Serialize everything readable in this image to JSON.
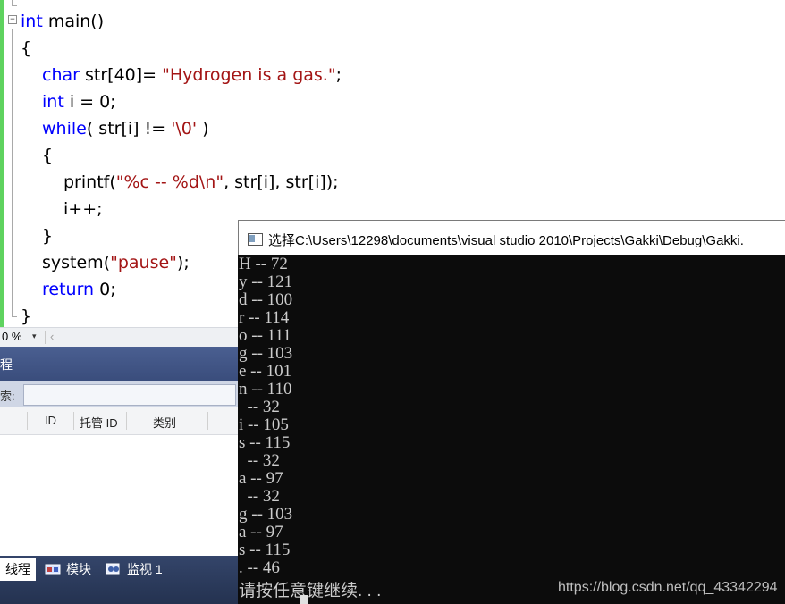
{
  "editor": {
    "lines": [
      {
        "parts": [
          {
            "t": "int",
            "c": "kw"
          },
          {
            "t": " main()",
            "c": ""
          }
        ]
      },
      {
        "parts": [
          {
            "t": "{",
            "c": ""
          }
        ]
      },
      {
        "parts": [
          {
            "t": "char",
            "c": "kw"
          },
          {
            "t": " str[40]= ",
            "c": ""
          },
          {
            "t": "\"Hydrogen is a gas.\"",
            "c": "str"
          },
          {
            "t": ";",
            "c": ""
          }
        ]
      },
      {
        "parts": [
          {
            "t": "int",
            "c": "kw"
          },
          {
            "t": " i = 0;",
            "c": ""
          }
        ]
      },
      {
        "parts": [
          {
            "t": "while",
            "c": "kw"
          },
          {
            "t": "( str[i] != ",
            "c": ""
          },
          {
            "t": "'\\0'",
            "c": "str"
          },
          {
            "t": " )",
            "c": ""
          }
        ]
      },
      {
        "parts": [
          {
            "t": "{",
            "c": ""
          }
        ]
      },
      {
        "parts": [
          {
            "t": "printf(",
            "c": ""
          },
          {
            "t": "\"%c -- %d\\n\"",
            "c": "str"
          },
          {
            "t": ", str[i], str[i]);",
            "c": ""
          }
        ]
      },
      {
        "parts": [
          {
            "t": "i++;",
            "c": ""
          }
        ]
      },
      {
        "parts": [
          {
            "t": "}",
            "c": ""
          }
        ]
      },
      {
        "parts": [
          {
            "t": "system(",
            "c": ""
          },
          {
            "t": "\"pause\"",
            "c": "str"
          },
          {
            "t": ");",
            "c": ""
          }
        ]
      },
      {
        "parts": [
          {
            "t": "return",
            "c": "kw"
          },
          {
            "t": " 0;",
            "c": ""
          }
        ]
      },
      {
        "parts": [
          {
            "t": "}",
            "c": ""
          }
        ]
      }
    ],
    "collapse_glyph": "−",
    "zoom": "0 %",
    "zoom_dropdown": "▾",
    "scroll_left": "‹"
  },
  "threads_panel": {
    "title": "程",
    "search_label": "索:",
    "columns": [
      "ID",
      "托管 ID",
      "类别"
    ]
  },
  "bottom_tabs": [
    {
      "label": "线程",
      "icon": "threads-icon",
      "active": true
    },
    {
      "label": "模块",
      "icon": "modules-icon",
      "active": false
    },
    {
      "label": "监视 1",
      "icon": "watch-icon",
      "active": false
    }
  ],
  "console": {
    "title": "选择C:\\Users\\12298\\documents\\visual studio 2010\\Projects\\Gakki\\Debug\\Gakki.",
    "output": [
      "H -- 72",
      "y -- 121",
      "d -- 100",
      "r -- 114",
      "o -- 111",
      "g -- 103",
      "e -- 101",
      "n -- 110",
      "  -- 32",
      "i -- 105",
      "s -- 115",
      "  -- 32",
      "a -- 97",
      "  -- 32",
      "g -- 103",
      "a -- 97",
      "s -- 115",
      ". -- 46"
    ],
    "prompt": "请按任意键继续. . .",
    "watermark": "https://blog.csdn.net/qq_43342294"
  },
  "colors": {
    "keyword": "#0000ff",
    "string": "#a31515",
    "console_bg": "#0c0c0c",
    "gutter_green": "#5fd35f"
  }
}
